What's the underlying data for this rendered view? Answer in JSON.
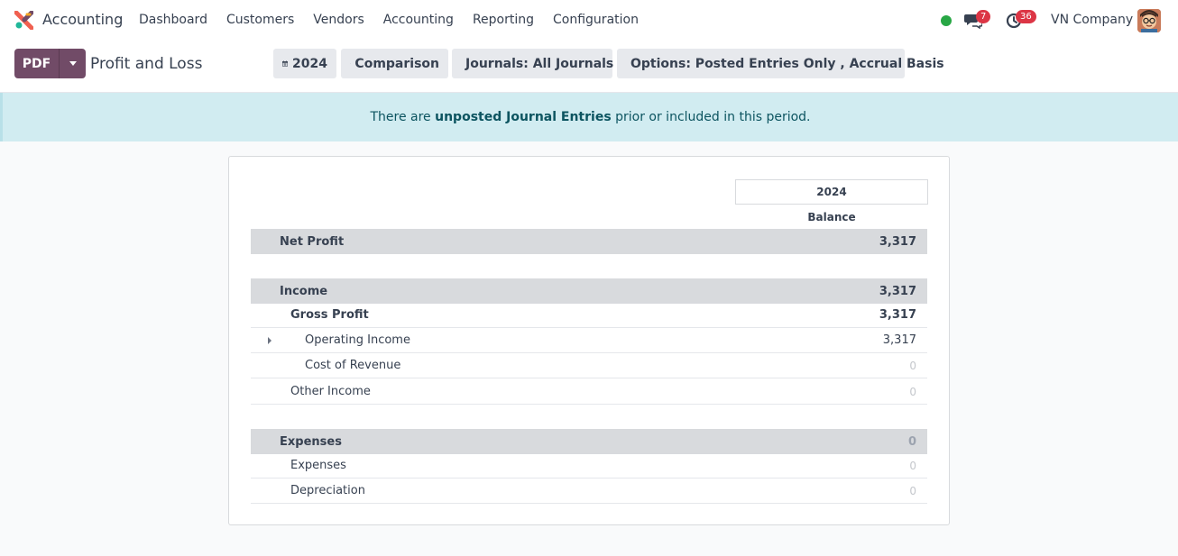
{
  "navbar": {
    "app_name": "Accounting",
    "menu": [
      "Dashboard",
      "Customers",
      "Vendors",
      "Accounting",
      "Reporting",
      "Configuration"
    ],
    "messages_count": "7",
    "activities_count": "36",
    "company": "VN Company"
  },
  "control": {
    "pdf_label": "PDF",
    "title": "Profit and Loss",
    "filter_date": "2024",
    "filter_comparison": "Comparison",
    "filter_journals": "Journals: All Journals",
    "filter_options": "Options: Posted Entries Only , Accrual Basis"
  },
  "alert": {
    "before": "There are ",
    "link": "unposted Journal Entries",
    "after": " prior or included in this period."
  },
  "report": {
    "column_header": "2024",
    "column_sub": "Balance",
    "rows": [
      {
        "label": "Net Profit",
        "value": "3,317"
      },
      {
        "label": "Income",
        "value": "3,317"
      },
      {
        "label": "Gross Profit",
        "value": "3,317"
      },
      {
        "label": "Operating Income",
        "value": "3,317"
      },
      {
        "label": "Cost of Revenue",
        "value": "0"
      },
      {
        "label": "Other Income",
        "value": "0"
      },
      {
        "label": "Expenses",
        "value": "0"
      },
      {
        "label": "Expenses",
        "value": "0"
      },
      {
        "label": "Depreciation",
        "value": "0"
      }
    ]
  },
  "colors": {
    "brand": "#714b67",
    "alert_bg": "#d1ecf1",
    "alert_text": "#0c5460",
    "row_shade": "#d8dadd",
    "badge": "#dc3545",
    "presence": "#28a745"
  }
}
